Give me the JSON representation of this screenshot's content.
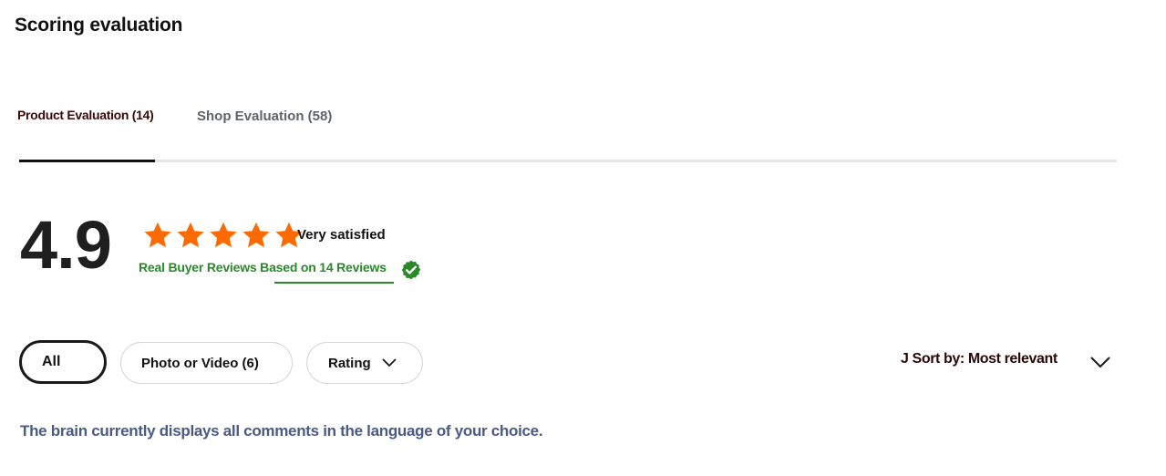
{
  "page": {
    "title": "Scoring evaluation"
  },
  "tabs": [
    {
      "label": "Product Evaluation (14)",
      "active": true
    },
    {
      "label": "Shop Evaluation (58)",
      "active": false
    }
  ],
  "summary": {
    "score": "4.9",
    "stars": 4.9,
    "star_max": 5,
    "satisfaction": "Very satisfied",
    "reviews_text": "Real Buyer Reviews Based on 14 Reviews",
    "verified_icon": "verified-check-badge"
  },
  "filters": {
    "all": "All",
    "photo_video": "Photo or Video (6)",
    "rating": "Rating"
  },
  "sort": {
    "label": "J Sort by: Most relevant"
  },
  "notice": "The brain currently displays all comments in the language of your choice.",
  "colors": {
    "star": "#ff6a00",
    "verified": "#2a8a2a",
    "tab_active_indicator": "#111111",
    "notice_text": "#4a5a86"
  }
}
